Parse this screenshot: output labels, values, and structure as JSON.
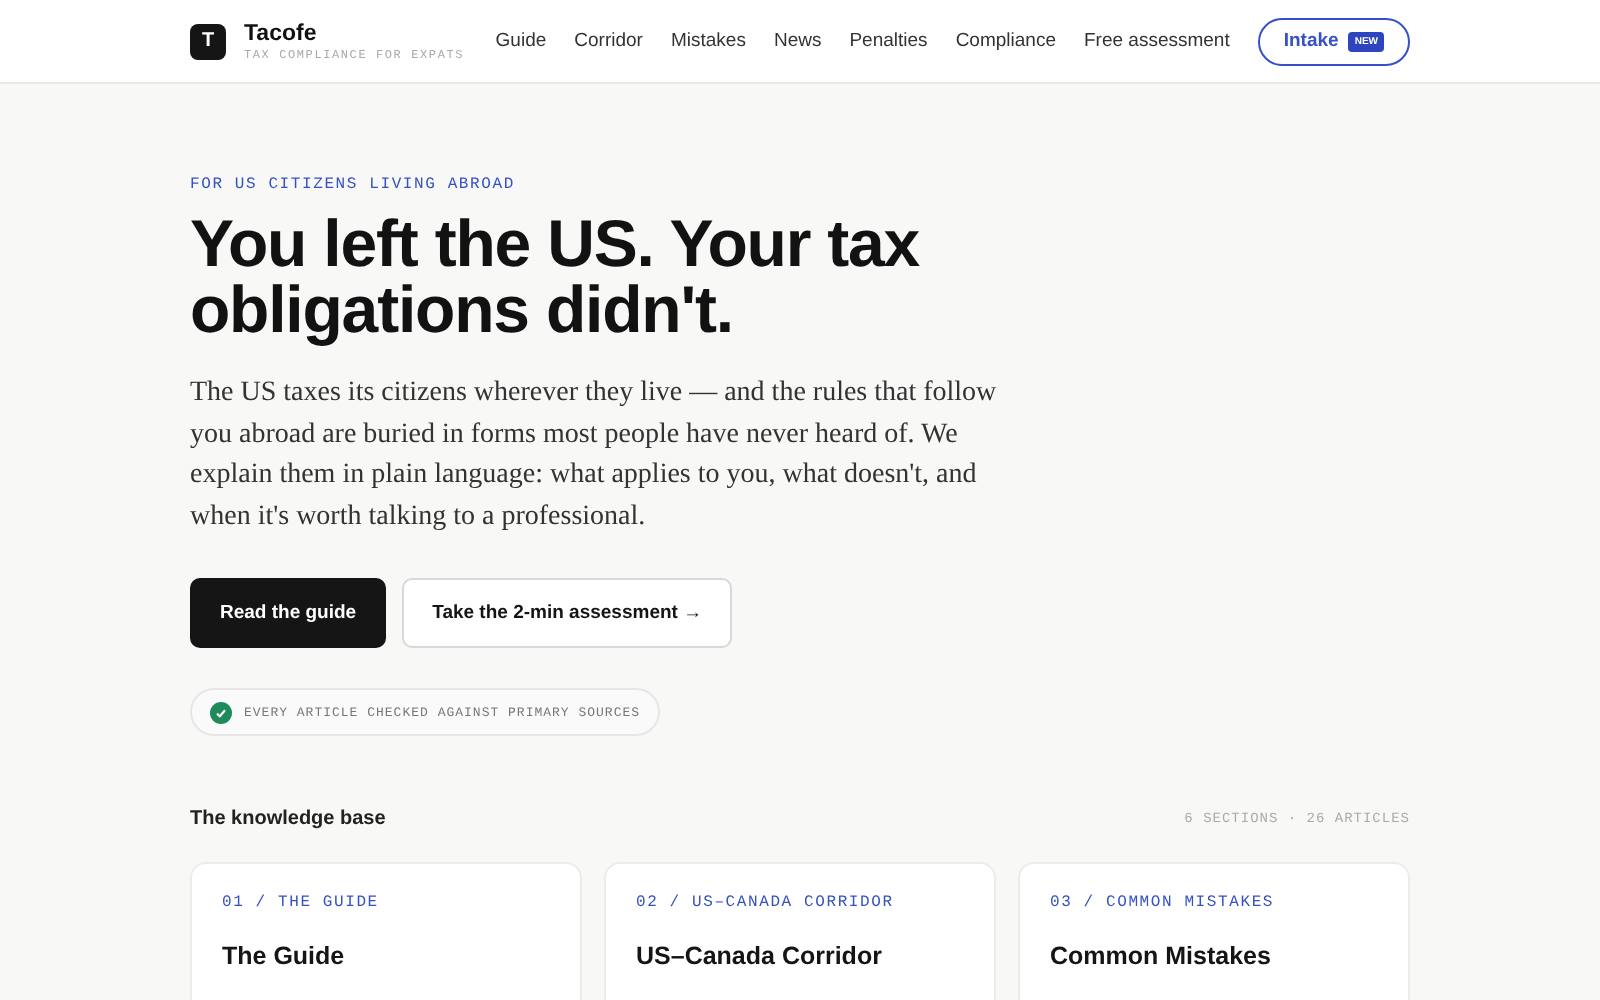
{
  "header": {
    "logo_letter": "T",
    "brand": "Tacofe",
    "tagline": "TAX COMPLIANCE FOR EXPATS",
    "nav": [
      {
        "label": "Guide"
      },
      {
        "label": "Corridor"
      },
      {
        "label": "Mistakes"
      },
      {
        "label": "News"
      },
      {
        "label": "Penalties"
      },
      {
        "label": "Compliance"
      },
      {
        "label": "Free assessment"
      }
    ],
    "cta": {
      "label": "Intake",
      "badge": "NEW"
    }
  },
  "hero": {
    "eyebrow": "FOR US CITIZENS LIVING ABROAD",
    "title": "You left the US. Your tax obligations didn't.",
    "body": "The US taxes its citizens wherever they live — and the rules that follow you abroad are buried in forms most people have never heard of. We explain them in plain language: what applies to you, what doesn't, and when it's worth talking to a professional.",
    "buttons": [
      {
        "label": "Read the guide",
        "kind": "primary"
      },
      {
        "label": "Take the 2-min assessment →",
        "kind": "secondary"
      }
    ],
    "note": "EVERY ARTICLE CHECKED AGAINST PRIMARY SOURCES"
  },
  "knowledge_base": {
    "title": "The knowledge base",
    "meta": "6 SECTIONS · 26 ARTICLES",
    "cards": [
      {
        "eyebrow": "01 / THE GUIDE",
        "title": "The Guide"
      },
      {
        "eyebrow": "02 / US–CANADA CORRIDOR",
        "title": "US–Canada Corridor"
      },
      {
        "eyebrow": "03 / COMMON MISTAKES",
        "title": "Common Mistakes"
      }
    ]
  }
}
